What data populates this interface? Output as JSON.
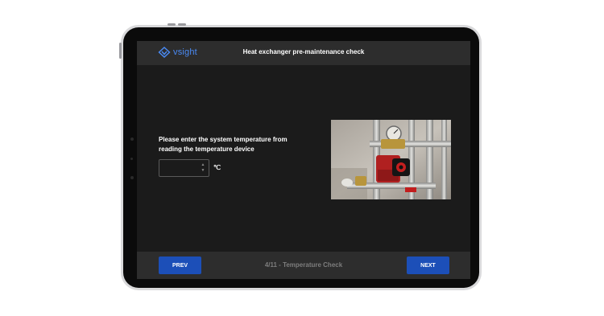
{
  "app": {
    "logo_text": "vsight",
    "title": "Heat exchanger pre-maintenance check"
  },
  "step": {
    "question": "Please enter the system temperature from reading the temperature device",
    "input_value": "",
    "unit": "℃"
  },
  "footer": {
    "prev_label": "PREV",
    "next_label": "NEXT",
    "progress_text": "4/11 - Temperature Check"
  },
  "colors": {
    "accent": "#1c4fb8",
    "logo": "#4a8bf5",
    "screen_bg": "#1b1b1b",
    "bar_bg": "#2d2d2d"
  }
}
